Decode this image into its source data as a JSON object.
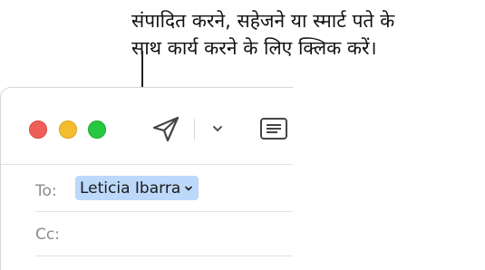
{
  "callout": {
    "text": "संपादित करने, सहेजने या स्मार्ट पते के\nसाथ कार्य करने के लिए क्लिक करें।"
  },
  "toolbar": {
    "send_icon": "paper-plane-icon",
    "menu_icon": "chevron-down-icon",
    "format_icon": "header-fields-icon"
  },
  "fields": {
    "to_label": "To:",
    "cc_label": "Cc:",
    "to_recipient": "Leticia Ibarra"
  },
  "colors": {
    "token_bg": "#bcd8fb",
    "close": "#ee5f57",
    "minimize": "#f4bd2f",
    "zoom": "#27c840"
  }
}
